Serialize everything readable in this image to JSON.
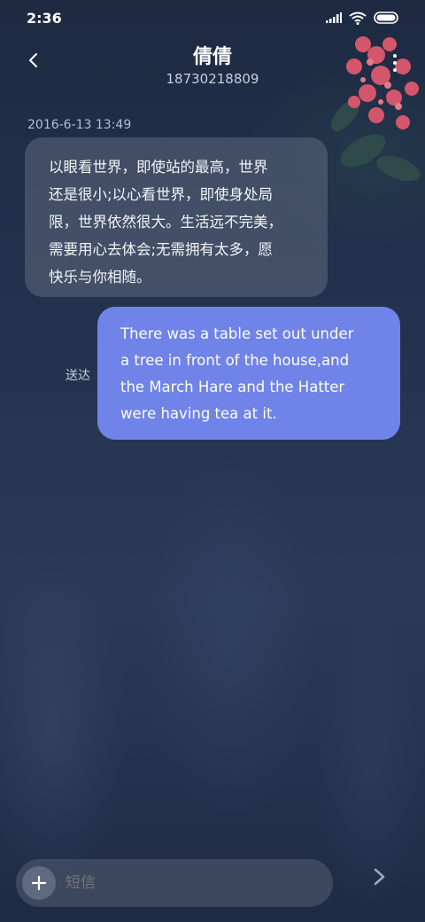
{
  "status_bar": {
    "time": "2:36"
  },
  "header": {
    "contact_name": "倩倩",
    "contact_number": "18730218809"
  },
  "conversation": {
    "timestamp": "2016-6-13 13:49",
    "incoming_lines": [
      "以眼看世界，即使站的最高，世界",
      "还是很小;以心看世界，即使身处局",
      "限，世界依然很大。生活远不完美，",
      "需要用心去体会;无需拥有太多，愿",
      "快乐与你相随。"
    ],
    "outgoing_lines": [
      "There was a table set out under",
      "a tree in front of the house,and",
      "the March Hare and the Hatter",
      "were having tea at it."
    ],
    "sent_status": "送达"
  },
  "composer": {
    "placeholder": "短信"
  },
  "colors": {
    "outgoing_bubble": "#6f83e8",
    "incoming_bubble": "#5f697d",
    "background": "#1f2c45"
  }
}
